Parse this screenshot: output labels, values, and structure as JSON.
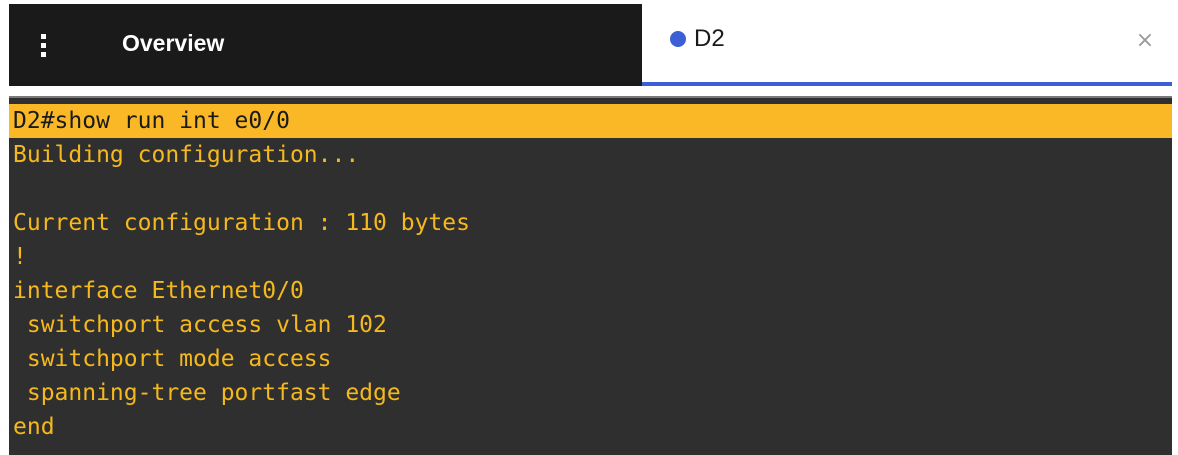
{
  "tabs": {
    "overview_label": "Overview",
    "active_label": "D2",
    "close_glyph": "×",
    "accent_color": "#3d5fd6",
    "menu_icon": "kebab-menu-icon"
  },
  "terminal": {
    "text_color": "#f5b91e",
    "highlight_color": "#fbb826",
    "background_color": "#2f2f2f",
    "lines": [
      "D2#show run int e0/0",
      "Building configuration...",
      "",
      "Current configuration : 110 bytes",
      "!",
      "interface Ethernet0/0",
      " switchport access vlan 102",
      " switchport mode access",
      " spanning-tree portfast edge",
      "end"
    ]
  }
}
